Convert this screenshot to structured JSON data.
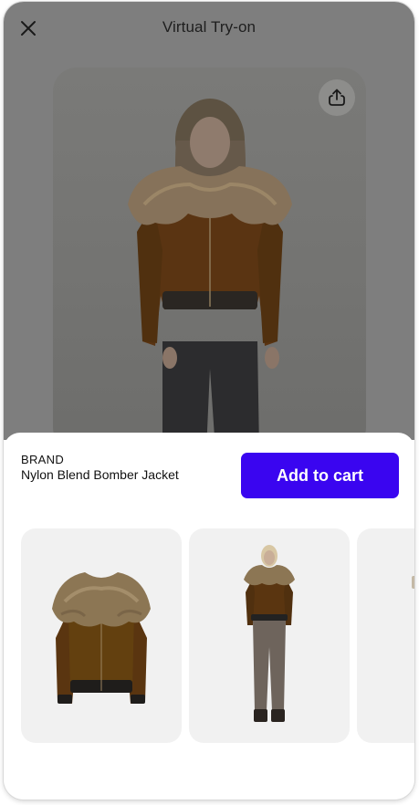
{
  "header": {
    "title": "Virtual Try-on",
    "close_icon": "close-icon",
    "share_icon": "share-icon"
  },
  "product": {
    "brand": "BRAND",
    "name": "Nylon Blend Bomber Jacket",
    "cta_label": "Add to cart"
  },
  "colors": {
    "accent": "#3a05f0",
    "overlay": "#7e7e7e",
    "card_bg": "#f1f1f1",
    "jacket": "#5a3412",
    "fur": "#8a7452"
  },
  "carousel": {
    "items": [
      {
        "kind": "product-image",
        "description": "jacket-only"
      },
      {
        "kind": "model-image",
        "description": "full-look"
      },
      {
        "kind": "model-image",
        "description": "partial"
      }
    ]
  }
}
